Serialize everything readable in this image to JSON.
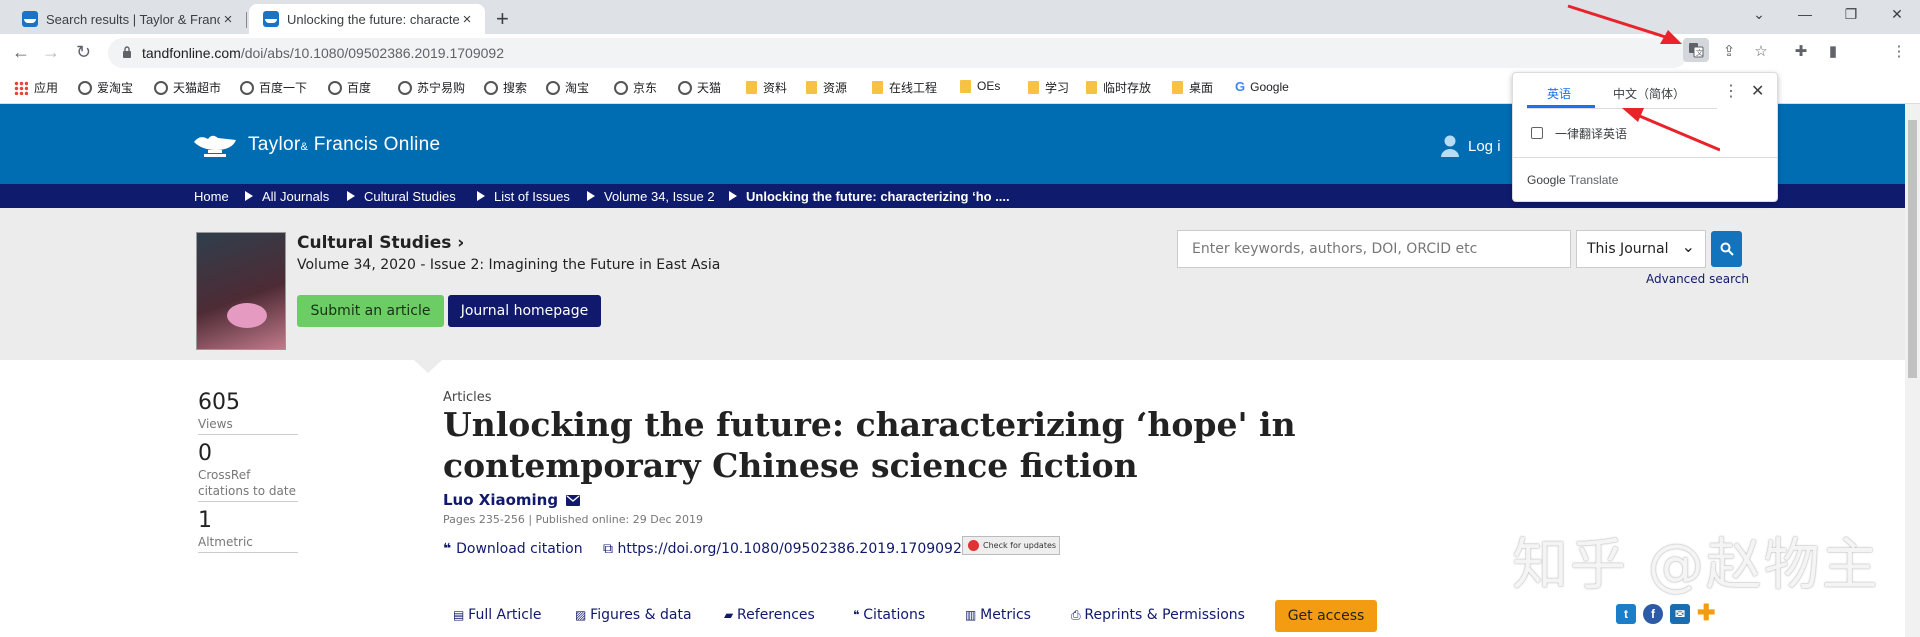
{
  "tabs": [
    {
      "title": "Search results | Taylor & Franc",
      "close": "×"
    },
    {
      "title": "Unlocking the future: characte",
      "close": "×"
    }
  ],
  "new_tab": "+",
  "window_controls": {
    "dropdown": "⌄",
    "minimize": "—",
    "maximize": "❐",
    "close": "✕"
  },
  "toolbar": {
    "url_domain": "tandfonline.com",
    "url_path": "/doi/abs/10.1080/09502386.2019.1709092"
  },
  "bookmarks": [
    {
      "label": "应用",
      "icon": "apps"
    },
    {
      "label": "爱淘宝",
      "icon": "globe"
    },
    {
      "label": "天猫超市",
      "icon": "globe"
    },
    {
      "label": "百度一下",
      "icon": "globe"
    },
    {
      "label": "百度",
      "icon": "globe"
    },
    {
      "label": "苏宁易购",
      "icon": "globe"
    },
    {
      "label": "搜索",
      "icon": "globe"
    },
    {
      "label": "淘宝",
      "icon": "globe"
    },
    {
      "label": "京东",
      "icon": "globe"
    },
    {
      "label": "天猫",
      "icon": "globe"
    },
    {
      "label": "资料",
      "icon": "folder"
    },
    {
      "label": "资源",
      "icon": "folder"
    },
    {
      "label": "在线工程",
      "icon": "folder"
    },
    {
      "label": "OEs",
      "icon": "folder"
    },
    {
      "label": "学习",
      "icon": "folder"
    },
    {
      "label": "临时存放",
      "icon": "folder"
    },
    {
      "label": "桌面",
      "icon": "folder"
    },
    {
      "label": "Google",
      "icon": "google"
    }
  ],
  "header": {
    "logo_main": "Taylor",
    "logo_amp": "&",
    "logo_rest": " Francis Online",
    "login": "Log i"
  },
  "breadcrumb": [
    "Home",
    "All Journals",
    "Cultural Studies",
    "List of Issues",
    "Volume 34, Issue 2",
    "Unlocking the future: characterizing ‘ho ...."
  ],
  "journal": {
    "name": "Cultural Studies ›",
    "issue": "Volume 34, 2020 - Issue 2: Imagining the Future in East Asia",
    "submit": "Submit an article",
    "homepage": "Journal homepage"
  },
  "search": {
    "placeholder": "Enter keywords, authors, DOI, ORCID etc",
    "scope": "This Journal",
    "advanced": "Advanced search"
  },
  "metrics": [
    {
      "value": "605",
      "label": "Views"
    },
    {
      "value": "0",
      "label": "CrossRef citations to date"
    },
    {
      "value": "1",
      "label": "Altmetric"
    }
  ],
  "article": {
    "type": "Articles",
    "title": "Unlocking the future: characterizing ‘hope' in contemporary Chinese science fiction",
    "author": "Luo Xiaoming",
    "pages": "Pages 235-256 | Published online: 29 Dec 2019",
    "download_citation": "Download citation",
    "doi": "https://doi.org/10.1080/09502386.2019.1709092",
    "check_updates": "Check for updates"
  },
  "article_tabs": [
    "Full Article",
    "Figures & data",
    "References",
    "Citations",
    "Metrics",
    "Reprints & Permissions"
  ],
  "get_access": "Get access",
  "watermark": "知乎 @赵物主",
  "translate": {
    "source": "英语",
    "target": "中文（简体）",
    "always": "一律翻译英语",
    "brand_google": "Google",
    "brand_translate": " Translate",
    "more": "⋮",
    "close": "✕"
  },
  "colors": {
    "header_blue": "#006db2",
    "breadcrumb_navy": "#0f1c6e",
    "submit_green": "#6ccd64",
    "access_orange": "#f39c12",
    "annotation_red": "#e8232a"
  }
}
